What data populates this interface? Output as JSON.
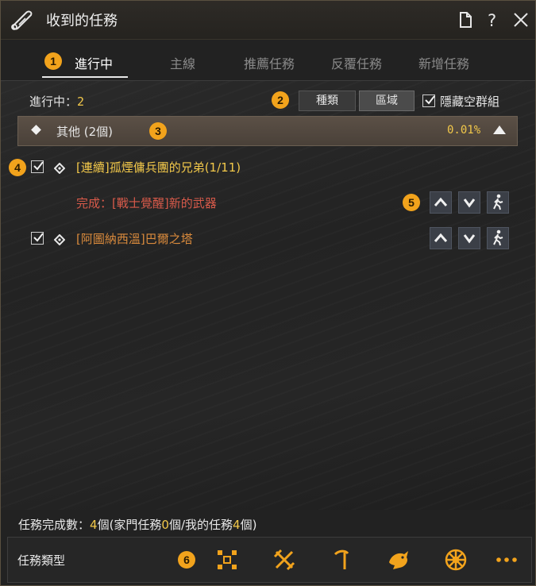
{
  "window": {
    "title": "收到的任務",
    "icon": "scroll-icon"
  },
  "tabs": [
    {
      "label": "進行中"
    },
    {
      "label": "主線"
    },
    {
      "label": "推薦任務"
    },
    {
      "label": "反覆任務"
    },
    {
      "label": "新增任務"
    }
  ],
  "markers": [
    "1",
    "2",
    "3",
    "4",
    "5",
    "6"
  ],
  "filters": {
    "in_progress_label": "進行中：",
    "in_progress_count": "2",
    "type_button": "種類",
    "region_button": "區域",
    "hide_empty_label": "隱藏空群組",
    "hide_empty_checked": true
  },
  "group": {
    "title": "其他 (2個)",
    "percent": "0.01%"
  },
  "quests": [
    {
      "title": "[連續]孤煙傭兵團的兄弟(1/11)",
      "title_color": "#f2c84a",
      "checked": true,
      "subtask": "完成：[戰士覺醒]新的武器"
    },
    {
      "title": "[阿圖納西溫]巴爾之塔",
      "title_color": "#d98a3c",
      "checked": true
    }
  ],
  "footer": {
    "stats_prefix": "任務完成數：",
    "total": "4",
    "unit1": "個(家門任務",
    "family": "0",
    "unit2": "個/我的任務",
    "mine": "4",
    "unit3": "個)"
  },
  "quest_types": {
    "label": "任務類型",
    "icons": [
      "grid-icon",
      "crossed-swords-icon",
      "pickaxe-icon",
      "fish-icon",
      "wheel-icon",
      "more-icon"
    ]
  },
  "colors": {
    "accent": "#f2a31c",
    "gold_text": "#f2c84a",
    "red_text": "#d85a4a"
  }
}
